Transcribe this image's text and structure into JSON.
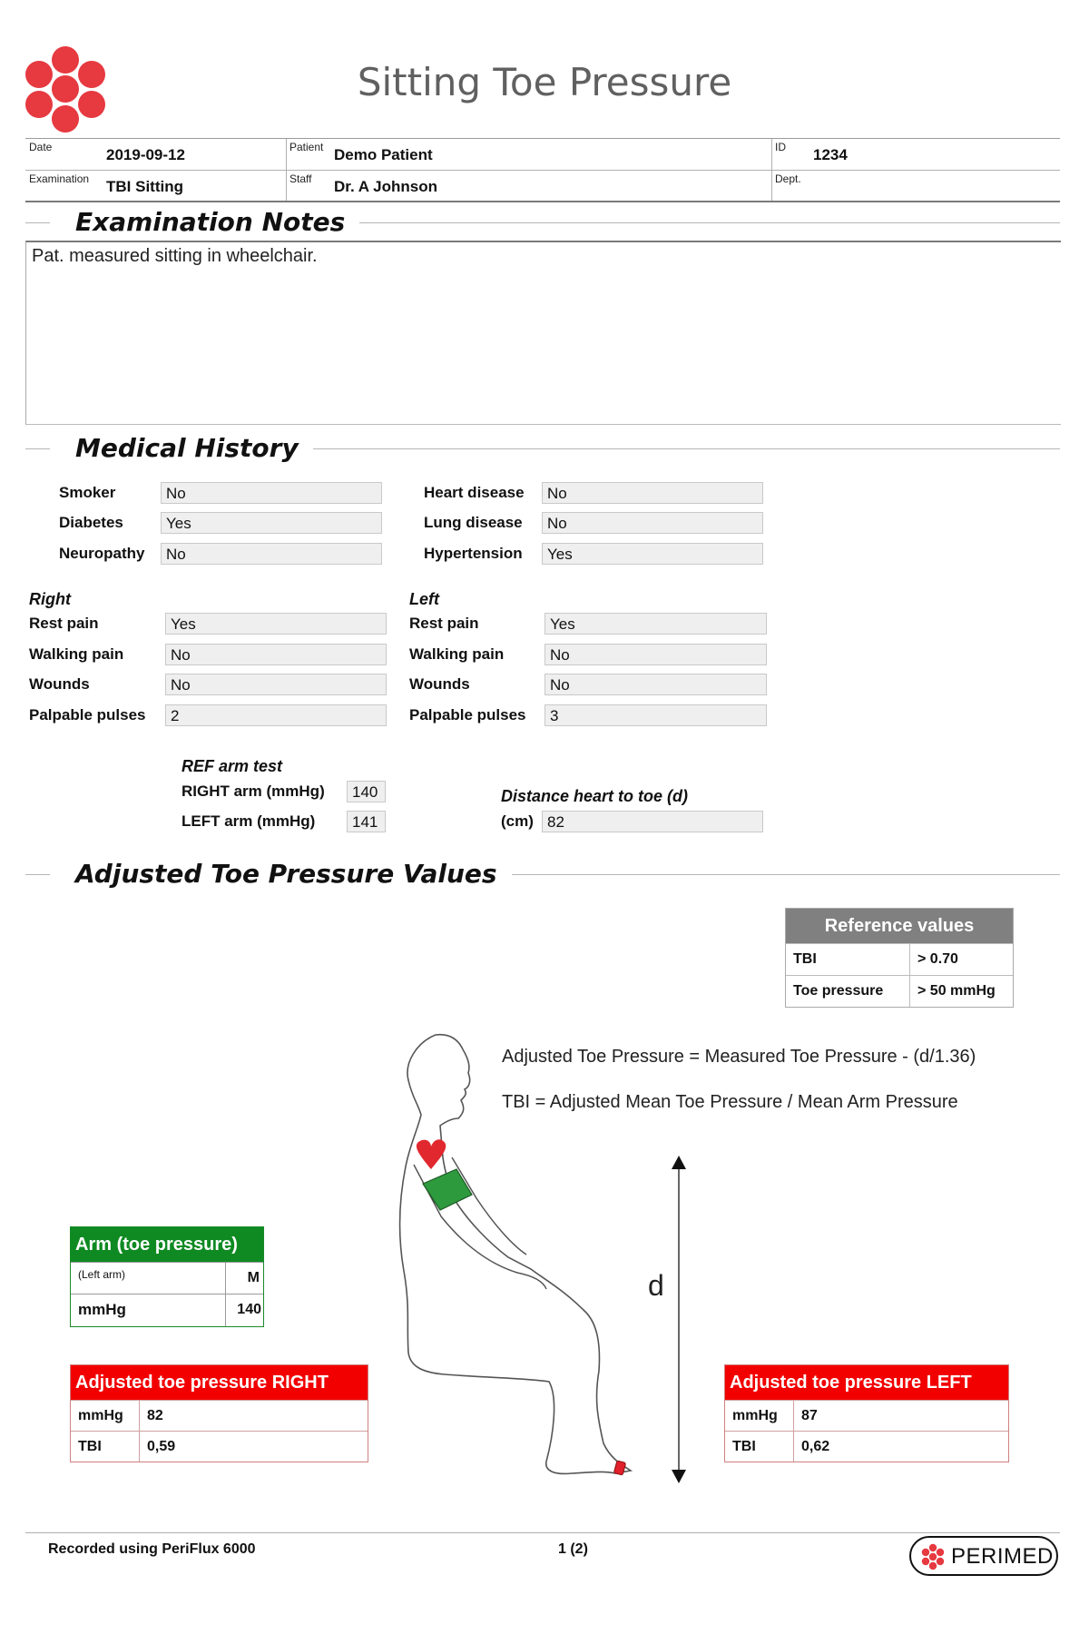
{
  "page": {
    "title": "Sitting Toe Pressure"
  },
  "brand": {
    "logo_color": "#e63940",
    "logo_icon": "perimed-dots-icon"
  },
  "header": {
    "date_label": "Date",
    "date": "2019-09-12",
    "patient_label": "Patient",
    "patient": "Demo Patient",
    "id_label": "ID",
    "id": "1234",
    "exam_label": "Examination",
    "exam": "TBI Sitting",
    "staff_label": "Staff",
    "staff": "Dr. A Johnson",
    "dept_label": "Dept.",
    "dept": ""
  },
  "sections": {
    "notes": "Examination Notes",
    "history": "Medical History",
    "adjusted": "Adjusted Toe Pressure Values"
  },
  "notes": {
    "text": "Pat. measured sitting in wheelchair."
  },
  "history": {
    "general_left": [
      {
        "label": "Smoker",
        "value": "No"
      },
      {
        "label": "Diabetes",
        "value": "Yes"
      },
      {
        "label": "Neuropathy",
        "value": "No"
      }
    ],
    "general_right": [
      {
        "label": "Heart disease",
        "value": "No"
      },
      {
        "label": "Lung disease",
        "value": "No"
      },
      {
        "label": "Hypertension",
        "value": "Yes"
      }
    ],
    "right": {
      "title": "Right",
      "rows": [
        {
          "label": "Rest pain",
          "value": "Yes"
        },
        {
          "label": "Walking pain",
          "value": "No"
        },
        {
          "label": "Wounds",
          "value": "No"
        },
        {
          "label": "Palpable pulses",
          "value": "2"
        }
      ]
    },
    "left": {
      "title": "Left",
      "rows": [
        {
          "label": "Rest pain",
          "value": "Yes"
        },
        {
          "label": "Walking pain",
          "value": "No"
        },
        {
          "label": "Wounds",
          "value": "No"
        },
        {
          "label": "Palpable pulses",
          "value": "3"
        }
      ]
    }
  },
  "ref_arm": {
    "title": "REF arm test",
    "right_label": "RIGHT arm (mmHg)",
    "right_value": "140",
    "left_label": "LEFT arm (mmHg)",
    "left_value": "141"
  },
  "distance": {
    "title": "Distance heart to toe (d)",
    "unit_label": "(cm)",
    "value": "82"
  },
  "reference": {
    "title": "Reference values",
    "rows": [
      {
        "label": "TBI",
        "value": "> 0.70"
      },
      {
        "label": "Toe pressure",
        "value": "> 50 mmHg"
      }
    ]
  },
  "formulas": {
    "line1": "Adjusted Toe Pressure = Measured Toe Pressure - (d/1.36)",
    "line2": "TBI =  Adjusted Mean Toe Pressure / Mean Arm Pressure"
  },
  "diagram": {
    "d_label": "d",
    "heart_color": "#e0282e",
    "cuff_color": "#2e9a3e",
    "toe_cuff_color": "#e0202a"
  },
  "arm_box": {
    "title": "Arm (toe pressure)",
    "sub_label": "(Left arm)",
    "sub_value": "M",
    "unit": "mmHg",
    "value": "140",
    "color": "#0f8a22"
  },
  "right_box": {
    "title": "Adjusted toe pressure RIGHT",
    "mmhg_label": "mmHg",
    "mmhg": "82",
    "tbi_label": "TBI",
    "tbi": "0,59",
    "color": "#f20000"
  },
  "left_box": {
    "title": "Adjusted toe pressure LEFT",
    "mmhg_label": "mmHg",
    "mmhg": "87",
    "tbi_label": "TBI",
    "tbi": "0,62",
    "color": "#f20000"
  },
  "footer": {
    "recorded": "Recorded using PeriFlux 6000",
    "page": "1 (2)",
    "brand": "PERIMED"
  }
}
